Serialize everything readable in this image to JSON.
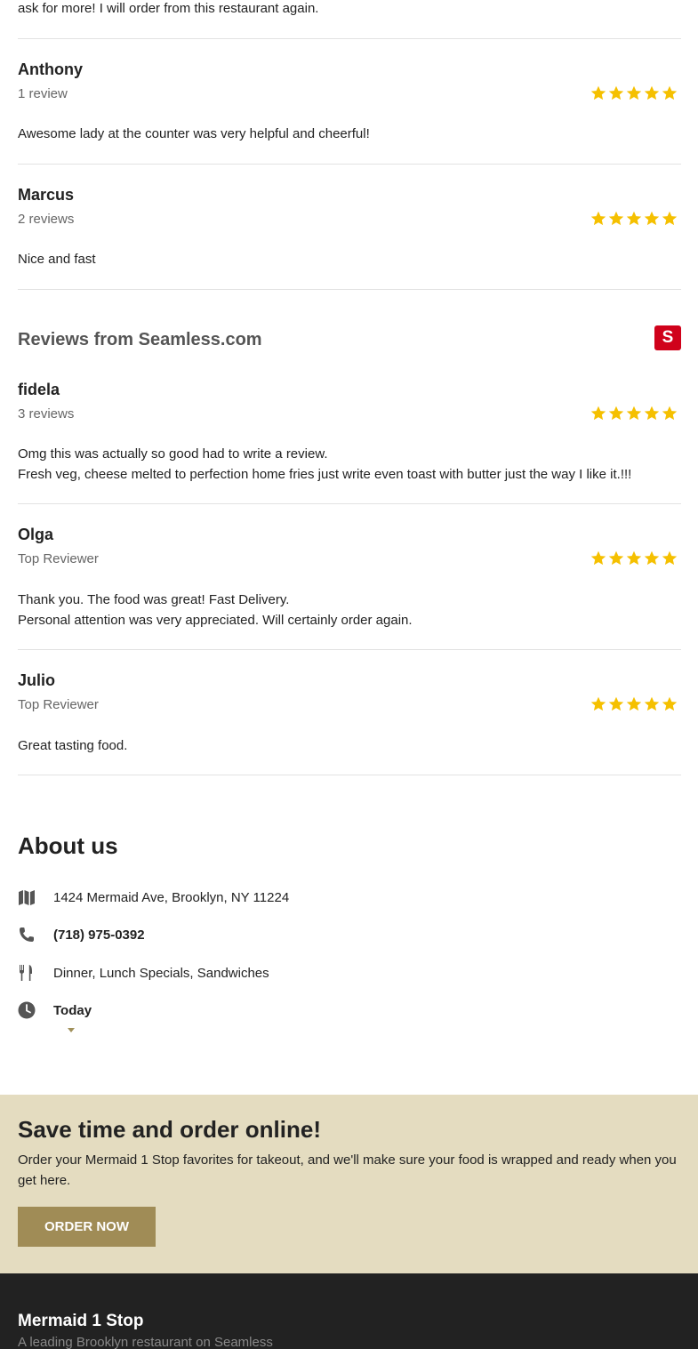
{
  "partial_review_text": "ask for more! I will order from this restaurant again.",
  "reviews_top": [
    {
      "name": "Anthony",
      "meta": "1 review",
      "rating": 5,
      "text": [
        "Awesome lady at the counter was very helpful and cheerful!"
      ]
    },
    {
      "name": "Marcus",
      "meta": "2 reviews",
      "rating": 5,
      "text": [
        "Nice and fast"
      ]
    }
  ],
  "seamless_section": {
    "title": "Reviews from Seamless.com",
    "logo_letter": "S",
    "reviews": [
      {
        "name": "fidela",
        "meta": "3 reviews",
        "rating": 5,
        "text": [
          "Omg this was actually so good had to write a review.",
          "Fresh veg, cheese melted to perfection home fries just write even toast with butter just the way I like it.!!!"
        ]
      },
      {
        "name": "Olga",
        "meta": "Top Reviewer",
        "rating": 5,
        "text": [
          "Thank you. The food was great! Fast Delivery.",
          "Personal attention was very appreciated. Will certainly order again."
        ]
      },
      {
        "name": "Julio",
        "meta": "Top Reviewer",
        "rating": 5,
        "text": [
          "Great tasting food."
        ]
      }
    ]
  },
  "about": {
    "title": "About us",
    "address": "1424 Mermaid Ave, Brooklyn, NY 11224",
    "phone": "(718) 975-0392",
    "cuisine": "Dinner, Lunch Specials, Sandwiches",
    "hours_label": "Today",
    "icons": [
      "map-icon",
      "phone-icon",
      "utensils-icon",
      "clock-icon"
    ]
  },
  "cta": {
    "title": "Save time and order online!",
    "text": "Order your Mermaid 1 Stop favorites for takeout, and we'll make sure your food is wrapped and ready when you get here.",
    "button_label": "ORDER NOW"
  },
  "footer": {
    "title": "Mermaid 1 Stop",
    "subtitle": "A leading Brooklyn restaurant on Seamless"
  },
  "colors": {
    "star": "#f5c000",
    "cta_bg": "#e4dcc0",
    "button_bg": "#a08c56",
    "footer_bg": "#222222",
    "seamless_red": "#d0021b",
    "icon": "#555555"
  }
}
